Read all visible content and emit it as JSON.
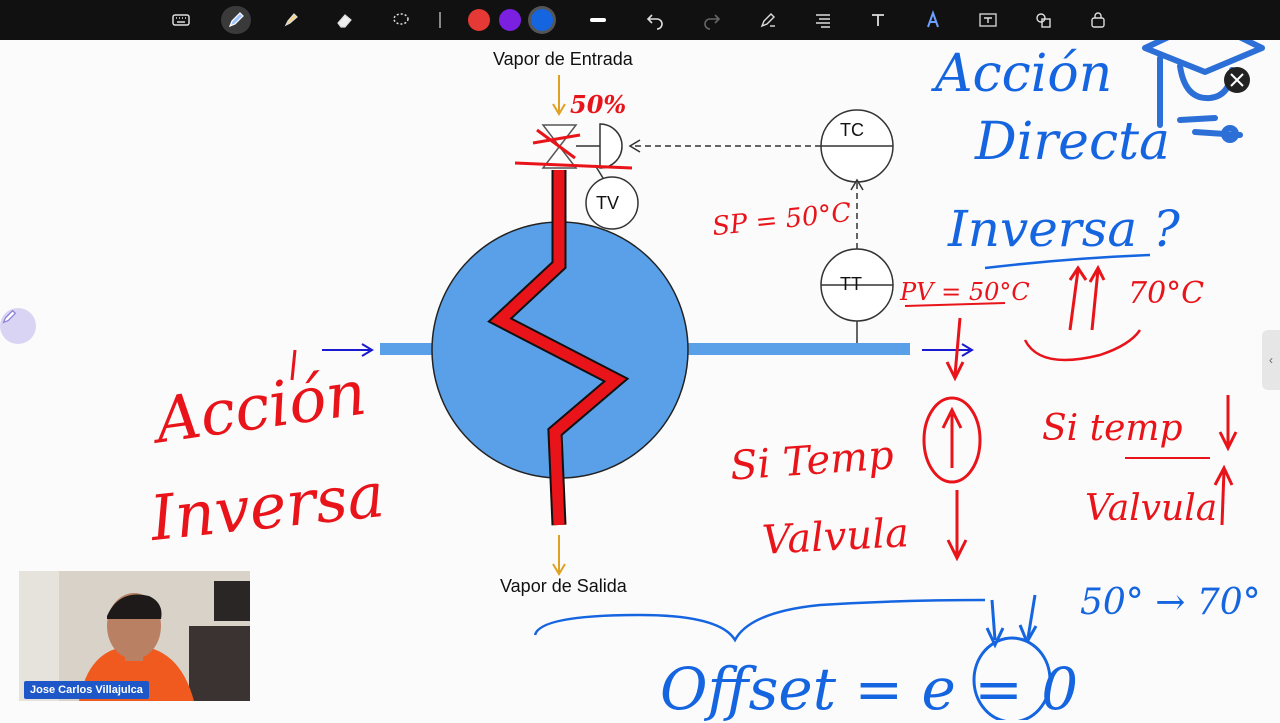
{
  "toolbar": {
    "tools": [
      "keyboard-icon",
      "pen-icon",
      "highlighter-icon",
      "eraser-icon",
      "lasso-icon"
    ],
    "colors": [
      "#e53935",
      "#7b1fe0",
      "#1565e0"
    ],
    "selected_color": "#1565e0",
    "actions": [
      "stroke-width-icon",
      "undo-icon",
      "redo-icon",
      "pen-settings-icon",
      "text-align-icon",
      "text-tool-icon",
      "shape-fill-icon",
      "text-box-icon",
      "shapes-icon",
      "lock-icon"
    ]
  },
  "diagram": {
    "inlet_label": "Vapor de Entrada",
    "outlet_label": "Vapor de Salida",
    "tc_label": "TC",
    "tt_label": "TT",
    "tv_label": "TV"
  },
  "annotations": {
    "valve_percent": "50%",
    "sp": "SP = 50°C",
    "pv": "PV = 50°C",
    "temp_70": "70°C",
    "accion_directa_1": "Acción",
    "accion_directa_2": "Directa",
    "inversa_q": "Inversa ?",
    "accion_inversa_1": "Acción",
    "accion_inversa_2": "Inversa",
    "si_temp_1": "Si Temp",
    "valvula_1": "Valvula",
    "si_temp_2": "Si temp",
    "valvula_2": "Valvula",
    "range": "50° → 70°",
    "offset": "Offset = e = 0"
  },
  "video": {
    "participant_name": "Jose Carlos Villajulca"
  }
}
